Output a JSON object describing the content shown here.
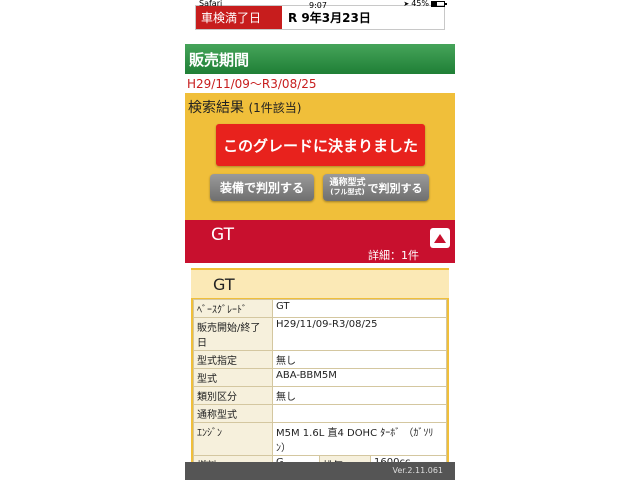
{
  "status_bar": {
    "carrier": "Safari",
    "time": "9:07",
    "battery": "45%",
    "battery_level": 0.45
  },
  "inspection": {
    "label": "車検満了日",
    "value": "R 9年3月23日"
  },
  "sale_period": {
    "header": "販売期間",
    "value": "H29/11/09〜R3/08/25"
  },
  "search": {
    "title": "検索結果",
    "count": "(1件該当)",
    "decide_button": "このグレードに決まりました",
    "equip_button": "装備で判別する",
    "model_button_line1": "通称型式",
    "model_button_line2": "(フル型式)",
    "model_button_suffix": "で判別する"
  },
  "grade_band": {
    "title": "GT",
    "detail": "詳細：1件"
  },
  "card": {
    "title": "GT",
    "rows": [
      {
        "key": "ﾍﾞｰｽｸﾞﾚｰﾄﾞ",
        "value": "GT"
      },
      {
        "key": "販売開始/終了日",
        "value": "H29/11/09-R3/08/25"
      },
      {
        "key": "型式指定",
        "value": "無し"
      },
      {
        "key": "型式",
        "value": "ABA-BBM5M"
      },
      {
        "key": "類別区分",
        "value": "無し"
      },
      {
        "key": "通称型式",
        "value": ""
      },
      {
        "key": "ｴﾝｼﾞﾝ",
        "value": "M5M 1.6L 直4 DOHC ﾀｰﾎﾞ （ｶﾞｿﾘﾝ）"
      }
    ],
    "fuel": {
      "key": "燃料",
      "value": "G",
      "disp_key": "排気",
      "disp_value": "1600cc"
    }
  },
  "footer": {
    "version": "Ver.2.11.061"
  }
}
